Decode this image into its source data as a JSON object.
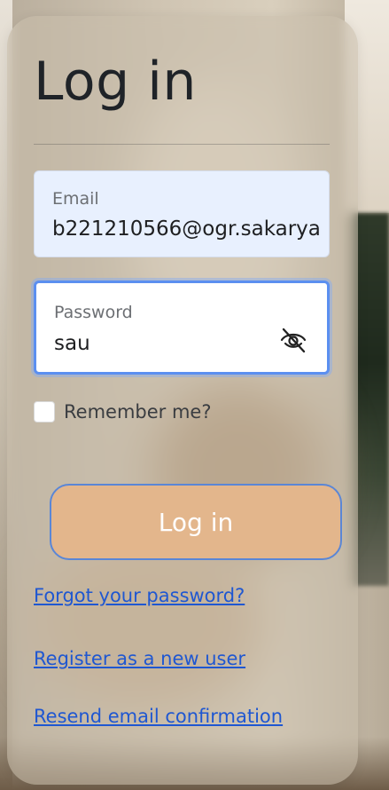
{
  "form": {
    "title": "Log in",
    "email": {
      "label": "Email",
      "value": "b221210566@ogr.sakarya"
    },
    "password": {
      "label": "Password",
      "value": "sau",
      "toggle_icon": "eye-off-icon"
    },
    "remember": {
      "label": "Remember me?",
      "checked": false
    },
    "submit_label": "Log in"
  },
  "links": {
    "forgot": "Forgot your password?",
    "register": "Register as a new user",
    "resend": "Resend email confirmation"
  },
  "colors": {
    "button_bg": "#e3b68c",
    "button_border": "#5a86d6",
    "focus_ring": "#5b8ff0",
    "autofill_bg": "#e8f0fe",
    "link": "#1f57d1"
  }
}
